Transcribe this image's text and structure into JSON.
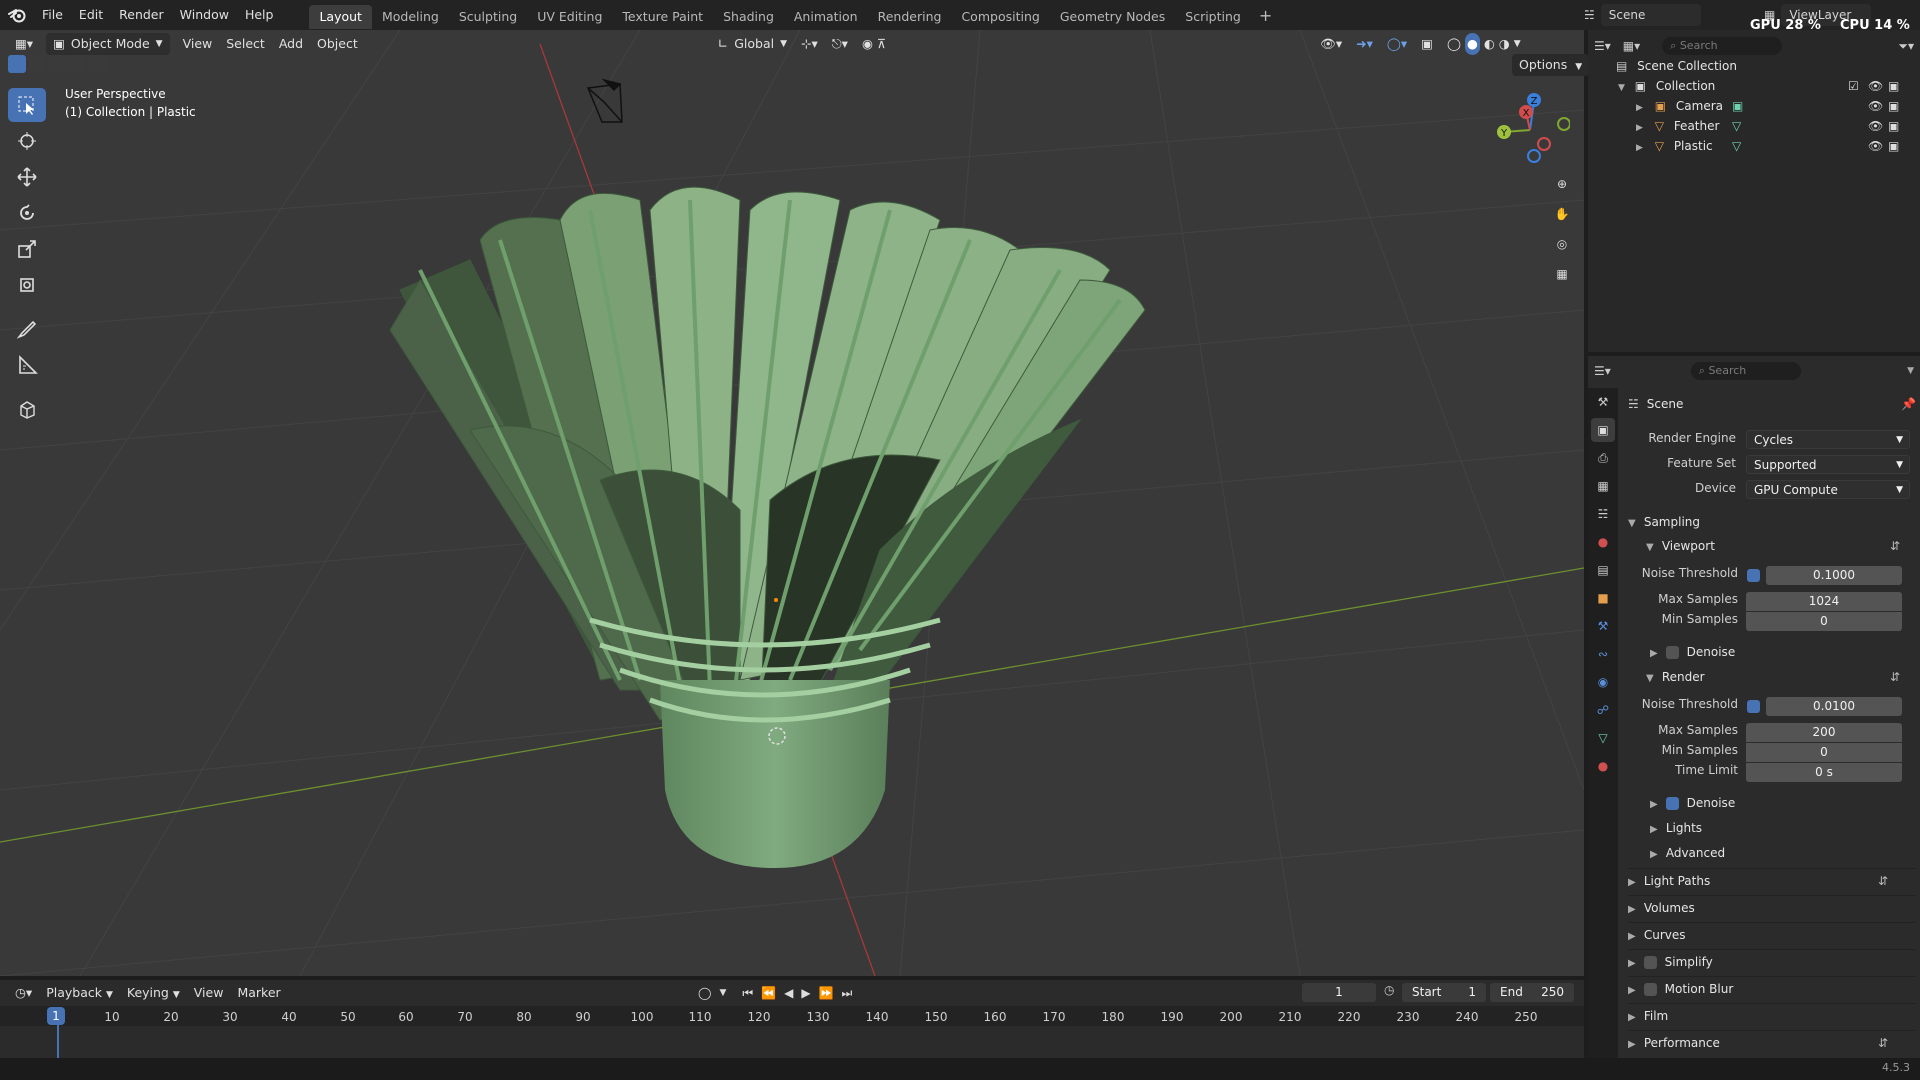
{
  "colors": {
    "accent": "#4772b3",
    "viewport_bg": "#393939",
    "panel_bg": "#2b2b2b",
    "axis_x": "#c23b3b",
    "axis_y": "#7da82f",
    "shuttle_green": "#7fa57c"
  },
  "menubar": {
    "items": [
      "File",
      "Edit",
      "Render",
      "Window",
      "Help"
    ]
  },
  "workspaces": {
    "active": "Layout",
    "tabs": [
      "Layout",
      "Modeling",
      "Sculpting",
      "UV Editing",
      "Texture Paint",
      "Shading",
      "Animation",
      "Rendering",
      "Compositing",
      "Geometry Nodes",
      "Scripting"
    ]
  },
  "topright": {
    "scene": "Scene",
    "view_layer": "ViewLayer",
    "gpu": "GPU 28 %",
    "cpu": "CPU 14 %",
    "search_placeholder": "Search"
  },
  "viewport_header": {
    "mode": "Object Mode",
    "menus": [
      "View",
      "Select",
      "Add",
      "Object"
    ],
    "orientation": "Global",
    "options": "Options"
  },
  "viewport_overlay": {
    "perspective": "User Perspective",
    "collection_info": "(1) Collection | Plastic"
  },
  "gizmo": {
    "x": "X",
    "y": "Y",
    "z": "Z"
  },
  "outliner": {
    "root": "Scene Collection",
    "collection": "Collection",
    "objects": [
      "Camera",
      "Feather",
      "Plastic"
    ]
  },
  "properties": {
    "search_placeholder": "Search",
    "context": "Scene",
    "render_engine": {
      "label": "Render Engine",
      "value": "Cycles"
    },
    "feature_set": {
      "label": "Feature Set",
      "value": "Supported"
    },
    "device": {
      "label": "Device",
      "value": "GPU Compute"
    },
    "sampling": {
      "title": "Sampling",
      "viewport": {
        "title": "Viewport",
        "noise_threshold_label": "Noise Threshold",
        "noise_threshold": "0.1000",
        "noise_threshold_enabled": true,
        "max_samples_label": "Max Samples",
        "max_samples": "1024",
        "min_samples_label": "Min Samples",
        "min_samples": "0",
        "denoise_label": "Denoise",
        "denoise_enabled": false
      },
      "render": {
        "title": "Render",
        "noise_threshold_label": "Noise Threshold",
        "noise_threshold": "0.0100",
        "noise_threshold_enabled": true,
        "max_samples_label": "Max Samples",
        "max_samples": "200",
        "min_samples_label": "Min Samples",
        "min_samples": "0",
        "time_limit_label": "Time Limit",
        "time_limit": "0 s",
        "denoise_label": "Denoise",
        "denoise_enabled": true
      },
      "lights": "Lights",
      "advanced": "Advanced"
    },
    "panels": [
      "Light Paths",
      "Volumes",
      "Curves",
      "Simplify",
      "Motion Blur",
      "Film",
      "Performance"
    ]
  },
  "timeline": {
    "menus": [
      "Playback",
      "Keying",
      "View",
      "Marker"
    ],
    "current_frame": "1",
    "start_label": "Start",
    "start": "1",
    "end_label": "End",
    "end": "250",
    "ticks": [
      "10",
      "20",
      "30",
      "40",
      "50",
      "60",
      "70",
      "80",
      "90",
      "100",
      "110",
      "120",
      "130",
      "140",
      "150",
      "160",
      "170",
      "180",
      "190",
      "200",
      "210",
      "220",
      "230",
      "240",
      "250"
    ],
    "playhead": "1"
  },
  "status": {
    "version": "4.5.3"
  }
}
